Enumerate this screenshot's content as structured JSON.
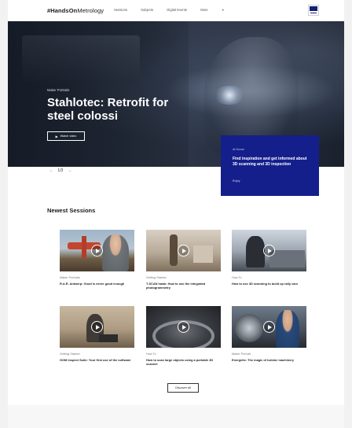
{
  "header": {
    "logo_bold": "#HandsOn",
    "logo_rest": "Metrology",
    "nav": [
      "Sessions",
      "Subjects",
      "Digital Events",
      "More"
    ],
    "brand_icon": "zeiss-logo"
  },
  "hero": {
    "eyebrow": "Maker Portraits",
    "title": "Stahlotec: Retrofit for steel colossi",
    "watch_label": "Watch video",
    "slide_counter": "1/3",
    "prev_icon": "arrow-left-icon",
    "next_icon": "arrow-right-icon"
  },
  "infobox": {
    "tag": "At Home",
    "text": "Find inspiration and get informed about 3D scanning and 3D inspection",
    "link": "Enjoy",
    "color": "#141f8c"
  },
  "sessions": {
    "title": "Newest Sessions",
    "cards": [
      {
        "category": "Maker Portraits",
        "title": "R.A.R. Antwerp: Good is never good enough"
      },
      {
        "category": "Getting Started",
        "title": "T-SCAN hawk: How to use the integrated photogrammetry"
      },
      {
        "category": "How To",
        "title": "How to use 3D scanning to build up rally cars"
      },
      {
        "category": "Getting Started",
        "title": "GOM Inspect Suite: Your first use of the software"
      },
      {
        "category": "How To",
        "title": "How to scan large objects using a portable 3D scanner"
      },
      {
        "category": "Maker Portrait",
        "title": "Energetic: The magic of turbine machinery"
      }
    ],
    "discover_label": "Discover all"
  }
}
